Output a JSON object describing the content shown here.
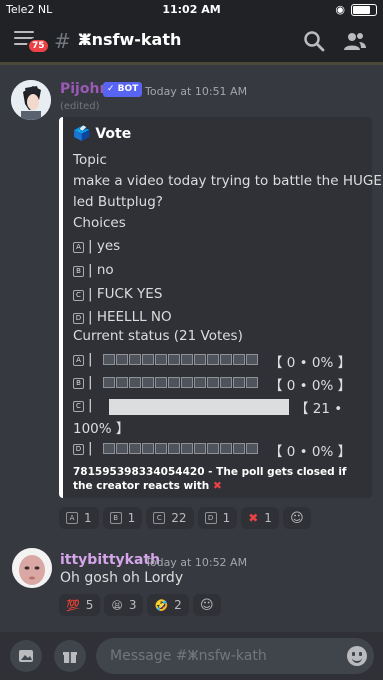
{
  "status_bar": {
    "carrier": "Tele2 NL",
    "time": "11:02 AM"
  },
  "header": {
    "badge": "75",
    "channel": "ⵥnsfw-kath"
  },
  "message1": {
    "author": "Pijohn",
    "bot_tag": "✓ BOT",
    "timestamp": "Today at 10:51 AM",
    "edited": "(edited)",
    "embed": {
      "title_icon": "🗳️",
      "title": "Vote",
      "topic_label": "Topic",
      "topic_line1": "make a video today trying to battle the HUGE",
      "topic_line2": "led Buttplug?",
      "choices_label": "Choices",
      "choices": [
        {
          "letter": "A",
          "text": "| yes"
        },
        {
          "letter": "B",
          "text": "| no"
        },
        {
          "letter": "C",
          "text": "| FUCK YES"
        },
        {
          "letter": "D",
          "text": "| HEELLL NO"
        }
      ],
      "status_label": "Current status (21 Votes)",
      "status": [
        {
          "letter": "A",
          "result": "【 0 • 0% 】",
          "votes": 0,
          "percent": 0
        },
        {
          "letter": "B",
          "result": "【 0 • 0% 】",
          "votes": 0,
          "percent": 0
        },
        {
          "letter": "C",
          "result": "【 21 •",
          "result_wrap": "100% 】",
          "votes": 21,
          "percent": 100
        },
        {
          "letter": "D",
          "result": "【 0 • 0% 】",
          "votes": 0,
          "percent": 0
        }
      ],
      "footer": "781595398334054420 - The poll gets closed if the creator reacts with",
      "footer_emoji": "✖"
    },
    "reactions": [
      {
        "letter": "A",
        "count": "1"
      },
      {
        "letter": "B",
        "count": "1"
      },
      {
        "letter": "C",
        "count": "22"
      },
      {
        "letter": "D",
        "count": "1"
      },
      {
        "emoji": "✖",
        "count": "1"
      }
    ]
  },
  "message2": {
    "author": "ittybittykath",
    "timestamp": "Today at 10:52 AM",
    "text": "Oh gosh oh Lordy",
    "reactions": [
      {
        "emoji": "💯",
        "count": "5"
      },
      {
        "emoji": "😫",
        "count": "3"
      },
      {
        "emoji": "🤣",
        "count": "2"
      }
    ]
  },
  "composer": {
    "placeholder": "Message #ⵥnsfw-kath"
  },
  "colors": {
    "bot_author": "#9b59b6",
    "user_author": "#d4a5e8",
    "blurple": "#5865f2",
    "background": "#36393f"
  }
}
